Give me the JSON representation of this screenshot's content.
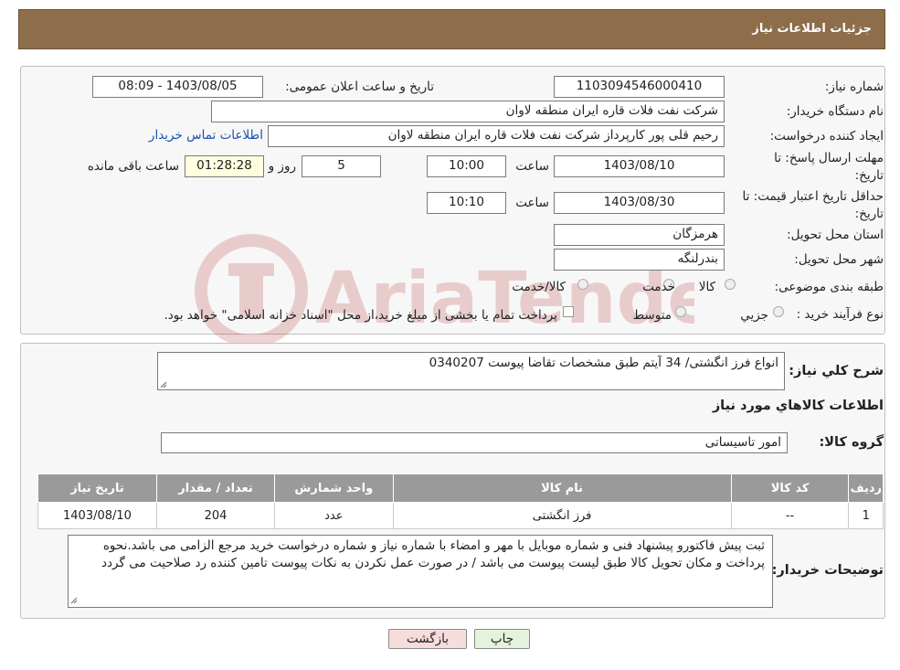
{
  "header": {
    "title": "جزئیات اطلاعات نیاز"
  },
  "watermark": {
    "text": "AriaTender.neT"
  },
  "fields": {
    "need_number_label": "شماره نیاز:",
    "need_number": "1103094546000410",
    "announce_label": "تاریخ و ساعت اعلان عمومی:",
    "announce_value": "1403/08/05 - 08:09",
    "buyer_org_label": "نام دستگاه خریدار:",
    "buyer_org": "شرکت نفت فلات قاره ایران منطقه لاوان",
    "requester_label": "ایجاد کننده درخواست:",
    "requester": "رحیم قلی پور کارپرداز شرکت نفت فلات قاره ایران منطقه لاوان",
    "contact_link": "اطلاعات تماس خریدار",
    "deadline_label_1": "مهلت ارسال پاسخ: تا",
    "deadline_label_2": "تاریخ:",
    "deadline_date": "1403/08/10",
    "time_label": "ساعت",
    "deadline_time": "10:00",
    "days_value": "5",
    "days_label": "روز و",
    "remaining_time": "01:28:28",
    "remaining_label": "ساعت باقی مانده",
    "validity_label_1": "حداقل تاریخ اعتبار قیمت: تا",
    "validity_label_2": "تاریخ:",
    "validity_date": "1403/08/30",
    "validity_time": "10:10",
    "province_label": "استان محل تحویل:",
    "province": "هرمزگان",
    "city_label": "شهر محل تحویل:",
    "city": "بندرلنگه",
    "category_label": "طبقه بندی موضوعی:",
    "category_options": [
      "کالا",
      "خدمت",
      "کالا/خدمت"
    ],
    "purchase_type_label": "نوع فرآیند خرید :",
    "purchase_options": [
      "جزیي",
      "متوسط"
    ],
    "payment_note": "پرداخت تمام یا بخشی از مبلغ خرید،از محل \"اسناد خزانه اسلامی\" خواهد بود."
  },
  "description": {
    "label": "شرح کلي نياز:",
    "value": "انواع فرز انگشتی/ 34 آیتم طبق مشخصات تقاضا پیوست 0340207"
  },
  "goods_info_title": "اطلاعات کالاهاي مورد نياز",
  "goods_group": {
    "label": "گروه کالا:",
    "value": "امور تاسیساتی"
  },
  "table": {
    "headers": [
      "ردیف",
      "کد کالا",
      "نام کالا",
      "واحد شمارش",
      "تعداد / مقدار",
      "تاریخ نیاز"
    ],
    "rows": [
      [
        "1",
        "--",
        "فرز انگشتی",
        "عدد",
        "204",
        "1403/08/10"
      ]
    ]
  },
  "buyer_notes": {
    "label": "توضیحات خریدار:",
    "value": "ثبت پیش فاکتورو پیشنهاد فنی و شماره موبایل با مهر و امضاء با شماره نیاز و شماره درخواست خرید مرجع الزامی می باشد.نحوه پرداخت و مکان تحویل کالا طبق لیست پیوست می باشد / در صورت عمل نکردن به نکات پیوست تامین کننده رد صلاحیت می گردد"
  },
  "buttons": {
    "print": "چاپ",
    "back": "بازگشت"
  },
  "colors": {
    "header_bg": "#8e6d4b",
    "link": "#1a4fb5",
    "table_header": "#9a9a9a",
    "back_btn_bg": "#f7dcdc",
    "print_btn_bg": "#e3f3dc"
  }
}
